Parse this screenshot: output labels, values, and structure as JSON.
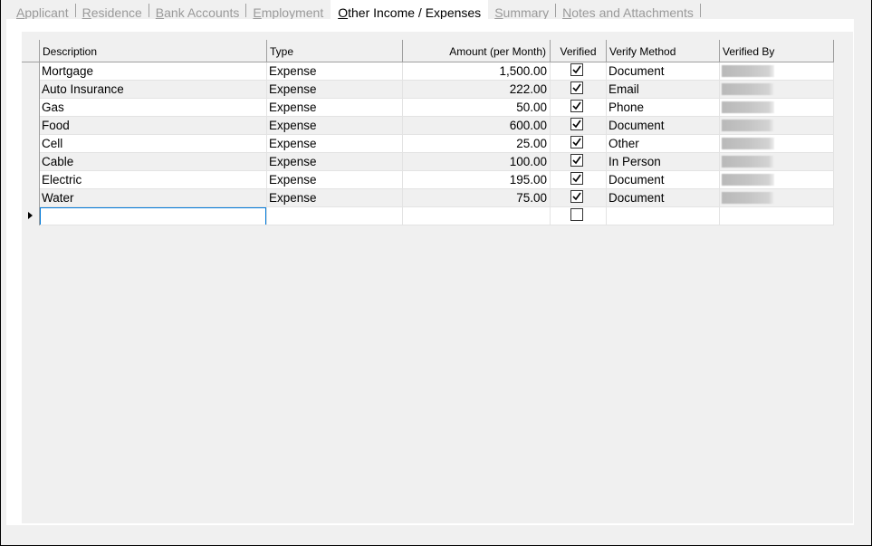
{
  "tabs": [
    {
      "label_pre": "",
      "label_ul": "A",
      "label_post": "pplicant",
      "active": false
    },
    {
      "label_pre": "",
      "label_ul": "R",
      "label_post": "esidence",
      "active": false
    },
    {
      "label_pre": "",
      "label_ul": "B",
      "label_post": "ank Accounts",
      "active": false
    },
    {
      "label_pre": "",
      "label_ul": "E",
      "label_post": "mployment",
      "active": false
    },
    {
      "label_pre": "",
      "label_ul": "O",
      "label_post": "ther Income / Expenses",
      "active": true
    },
    {
      "label_pre": "",
      "label_ul": "S",
      "label_post": "ummary",
      "active": false
    },
    {
      "label_pre": "",
      "label_ul": "N",
      "label_post": "otes and Attachments",
      "active": false
    }
  ],
  "grid": {
    "headers": {
      "description": "Description",
      "type": "Type",
      "amount": "Amount (per Month)",
      "verified": "Verified",
      "verify_method": "Verify Method",
      "verified_by": "Verified By"
    },
    "rows": [
      {
        "description": "Mortgage",
        "type": "Expense",
        "amount": "1,500.00",
        "verified": true,
        "verify_method": "Document"
      },
      {
        "description": "Auto Insurance",
        "type": "Expense",
        "amount": "222.00",
        "verified": true,
        "verify_method": "Email"
      },
      {
        "description": "Gas",
        "type": "Expense",
        "amount": "50.00",
        "verified": true,
        "verify_method": "Phone"
      },
      {
        "description": "Food",
        "type": "Expense",
        "amount": "600.00",
        "verified": true,
        "verify_method": "Document"
      },
      {
        "description": "Cell",
        "type": "Expense",
        "amount": "25.00",
        "verified": true,
        "verify_method": "Other"
      },
      {
        "description": "Cable",
        "type": "Expense",
        "amount": "100.00",
        "verified": true,
        "verify_method": "In Person"
      },
      {
        "description": "Electric",
        "type": "Expense",
        "amount": "195.00",
        "verified": true,
        "verify_method": "Document"
      },
      {
        "description": "Water",
        "type": "Expense",
        "amount": "75.00",
        "verified": true,
        "verify_method": "Document"
      }
    ],
    "new_row": {
      "description": "",
      "verified": false
    }
  },
  "icons": {
    "current_row": "row-pointer-icon",
    "check": "check-mark-icon"
  },
  "colors": {
    "selection_border": "#0078d7",
    "inactive_tab_text": "#9a9a9a"
  }
}
